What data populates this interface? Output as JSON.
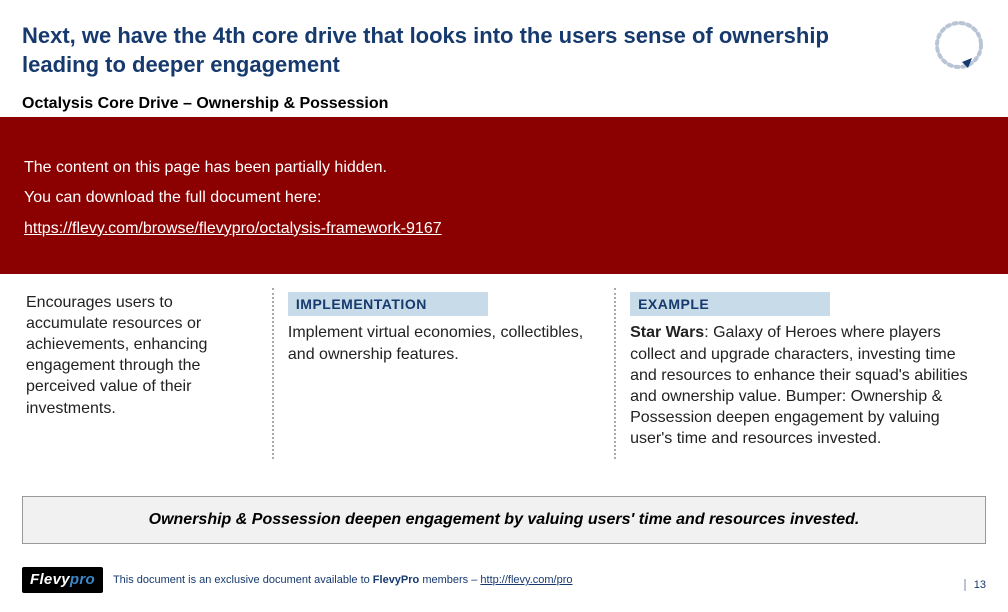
{
  "title": "Next, we have the 4th core drive that looks into the users sense of ownership leading to deeper engagement",
  "subtitle": "Octalysis Core Drive – Ownership & Possession",
  "overlay": {
    "line1": "The content on this page has been partially hidden.",
    "line2": "You can download the full document here:",
    "link_text": "https://flevy.com/browse/flevypro/octalysis-framework-9167",
    "link_href": "https://flevy.com/browse/flevypro/octalysis-framework-9167"
  },
  "columns": {
    "c1": {
      "body": "Encourages users to accumulate resources or achievements, enhancing engagement through the perceived value of their investments."
    },
    "c2": {
      "header": "IMPLEMENTATION",
      "body": "Implement virtual economies, collectibles, and ownership features."
    },
    "c3": {
      "header": "EXAMPLE",
      "body_prefix_bold": "Star Wars",
      "body_rest": ": Galaxy of Heroes where players collect and upgrade characters, investing time and resources to enhance their squad's abilities and ownership value. Bumper: Ownership & Possession deepen engagement by valuing user's time and resources invested."
    }
  },
  "bumper": "Ownership & Possession deepen engagement by valuing users' time and resources invested.",
  "footer": {
    "logo_main": "Flevy",
    "logo_accent": "pro",
    "text_prefix": "This document is an exclusive document available to ",
    "text_bold": "FlevyPro",
    "text_mid": " members – ",
    "text_link": "http://flevy.com/pro",
    "page": "13"
  }
}
